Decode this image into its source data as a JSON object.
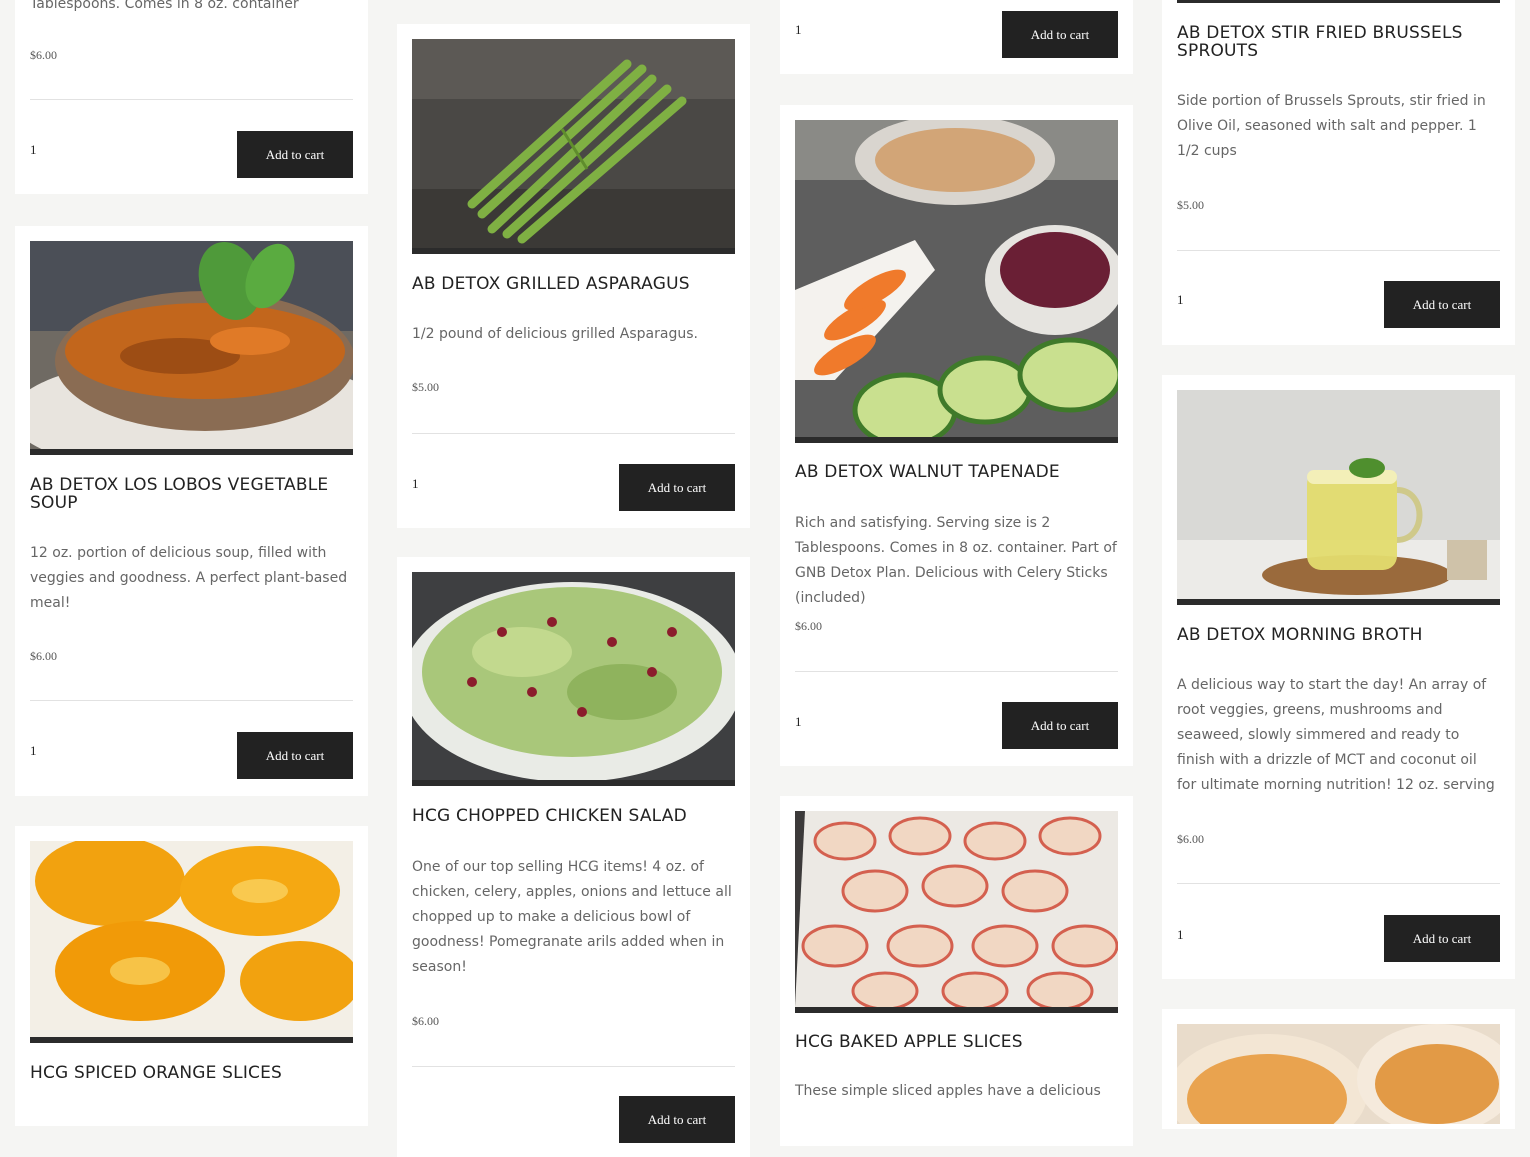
{
  "theme": {
    "page_bg": "#f5f5f3",
    "card_bg": "#ffffff",
    "button_bg": "#222222",
    "button_text": "#ffffff"
  },
  "common": {
    "add_to_cart": "Add to cart",
    "qty_default": "1"
  },
  "products": {
    "top_partial_desc": "Tablespoons. Comes in 8 oz. container",
    "top_partial_price": "$6.00",
    "veg_soup": {
      "title": "AB DETOX LOS LOBOS VEGETABLE SOUP",
      "desc": "12 oz. portion of delicious soup, filled with veggies and goodness. A perfect plant-based meal!",
      "price": "$6.00",
      "image": "vegetable-soup-bowl-photo"
    },
    "orange": {
      "title": "HCG SPICED ORANGE SLICES",
      "image": "orange-slices-photo"
    },
    "asparagus": {
      "title": "AB DETOX GRILLED ASPARAGUS",
      "desc": "1/2 pound of delicious grilled Asparagus.",
      "price": "$5.00",
      "image": "asparagus-bundle-photo"
    },
    "chicken_salad": {
      "title": "HCG CHOPPED CHICKEN SALAD",
      "desc": "One of our top selling HCG items! 4 oz. of chicken, celery, apples, onions and lettuce all chopped up to make a delicious bowl of goodness! Pomegranate arils added when in season!",
      "price": "$6.00",
      "image": "chicken-salad-photo"
    },
    "tapenade": {
      "title": "AB DETOX WALNUT TAPENADE",
      "desc": "Rich and satisfying. Serving size is 2 Tablespoons. Comes in 8 oz. container.  Part of GNB Detox Plan. Delicious with Celery Sticks (included)",
      "price": "$6.00",
      "image": "walnut-tapenade-veggies-photo"
    },
    "apple": {
      "title": "HCG BAKED APPLE SLICES",
      "desc": "These simple sliced apples have a delicious",
      "image": "baked-apple-slices-photo"
    },
    "brussels": {
      "title": "AB DETOX STIR FRIED BRUSSELS SPROUTS",
      "desc": "Side portion of Brussels Sprouts, stir fried in Olive Oil, seasoned with salt and pepper. 1 1/2 cups",
      "price": "$5.00"
    },
    "broth": {
      "title": "AB DETOX MORNING BROTH",
      "desc": "A delicious way to start the day! An array of root veggies, greens, mushrooms and seaweed, slowly simmered and ready to finish with a drizzle of MCT and coconut oil for ultimate morning nutrition! 12 oz. serving",
      "price": "$6.00",
      "image": "morning-broth-tea-glass-photo"
    },
    "bottom_partial": {
      "image": "baked-peach-dish-photo"
    }
  }
}
